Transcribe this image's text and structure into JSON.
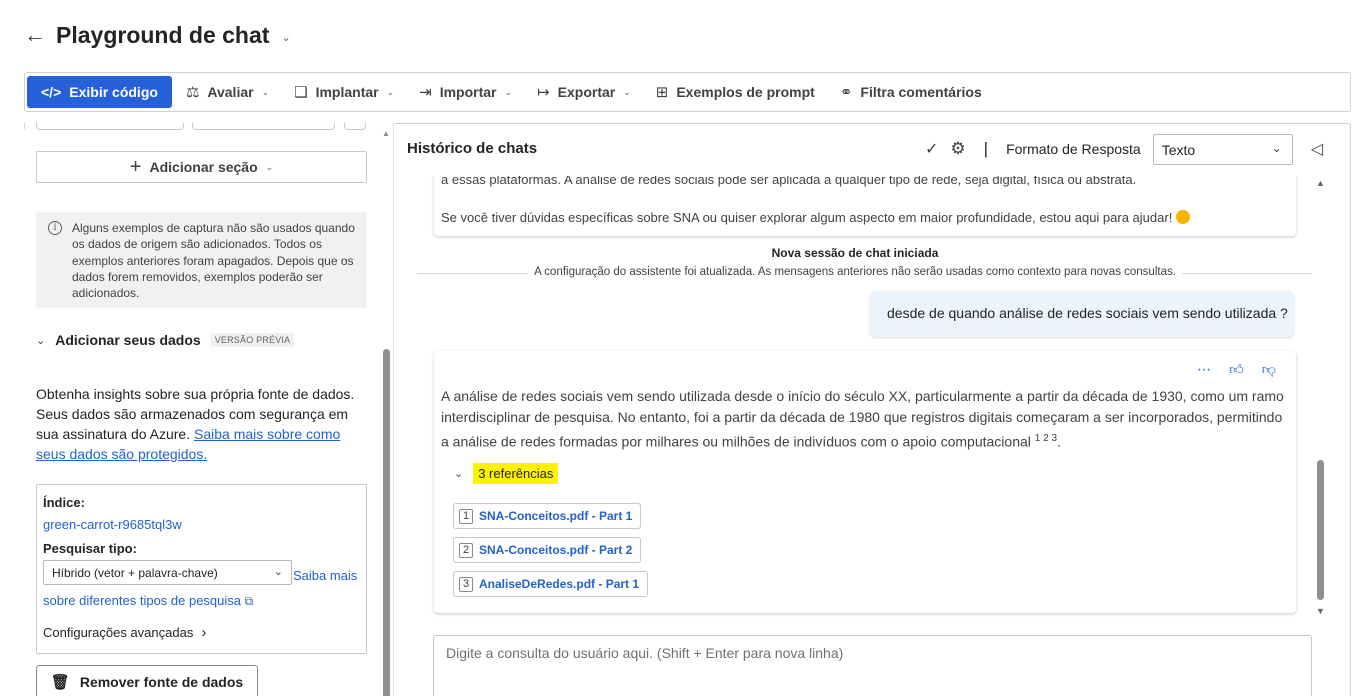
{
  "header": {
    "back_icon": "arrow-left-icon",
    "title": "Playground de chat"
  },
  "toolbar": {
    "view_code": "Exibir código",
    "evaluate": "Avaliar",
    "deploy": "Implantar",
    "import": "Importar",
    "export": "Exportar",
    "prompt_samples": "Exemplos de prompt",
    "filter_comments": "Filtra comentários",
    "accent_color": "#2761d9"
  },
  "left": {
    "add_section": "Adicionar seção",
    "info_text": "Alguns exemplos de captura não são usados quando os dados de origem são adicionados. Todos os exemplos anteriores foram apagados. Depois que os dados forem removidos, exemplos poderão ser adicionados.",
    "data_title": "Adicionar seus dados",
    "preview_badge": "VERSÃO PRÉVIA",
    "data_desc": "Obtenha insights sobre sua própria fonte de dados. Seus dados são armazenados com segurança em sua assinatura do Azure.",
    "data_link": "Saiba mais sobre como seus dados são protegidos.",
    "index_label": "Índice:",
    "index_value": "green-carrot-r9685tql3w",
    "search_type_label": "Pesquisar tipo:",
    "search_type_value": "Híbrido (vetor + palavra-chave)",
    "search_link": "Saiba mais sobre diferentes tipos de pesquisa",
    "advanced": "Configurações avançadas",
    "remove_source": "Remover fonte de dados"
  },
  "chat": {
    "title": "Histórico de chats",
    "format_label": "Formato de Resposta",
    "format_value": "Texto",
    "prev_line1": "a essas plataformas. A análise de redes sociais pode ser aplicada a qualquer tipo de rede, seja digital, física ou abstrata.",
    "prev_line2": "Se você tiver dúvidas específicas sobre SNA ou quiser explorar algum aspecto em maior profundidade, estou aqui para ajudar!",
    "session_title": "Nova sessão de chat iniciada",
    "session_sub": "A configuração do assistente foi atualizada. As mensagens anteriores não serão usadas como contexto para novas consultas.",
    "user_message": "desde de quando análise de redes sociais vem sendo utilizada ?",
    "answer": "A análise de redes sociais vem sendo utilizada desde o início do século XX, particularmente a partir da década de 1930, como um ramo interdisciplinar de pesquisa. No entanto, foi a partir da década de 1980 que registros digitais começaram a ser incorporados, permitindo a análise de redes formadas por milhares ou milhões de indivíduos com o apoio computacional",
    "citations": "1 2 3",
    "refs_toggle": "3 referências",
    "refs": [
      {
        "num": "1",
        "label": "SNA-Conceitos.pdf - Part 1"
      },
      {
        "num": "2",
        "label": "SNA-Conceitos.pdf - Part 2"
      },
      {
        "num": "3",
        "label": "AnaliseDeRedes.pdf - Part 1"
      }
    ],
    "input_placeholder": "Digite a consulta do usuário aqui. (Shift + Enter para nova linha)"
  }
}
